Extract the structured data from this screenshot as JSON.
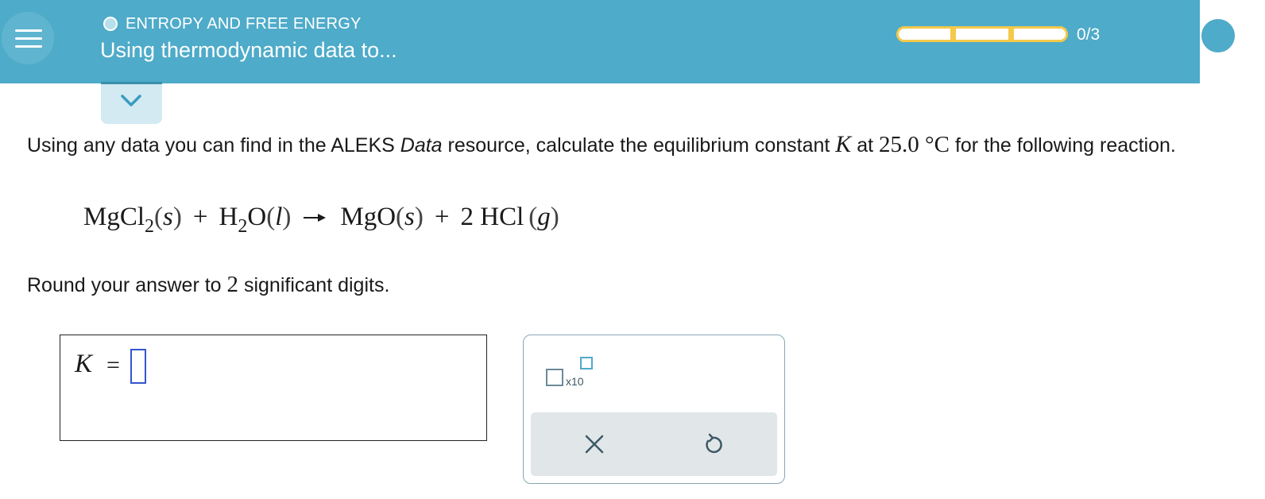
{
  "header": {
    "topic": "ENTROPY AND FREE ENERGY",
    "title": "Using thermodynamic data to...",
    "progress_text": "0/3",
    "progress_value": 0,
    "progress_total": 3,
    "background_color": "#4eabc9",
    "progress_color": "#f5c94a"
  },
  "icons": {
    "menu": "hamburger-menu-icon",
    "collapse": "chevron-down-icon",
    "clear": "close-icon",
    "undo": "undo-icon"
  },
  "question": {
    "part1": "Using any data you can find in the ALEKS ",
    "data_word": "Data",
    "part2": " resource, calculate the equilibrium constant ",
    "k_symbol": "K",
    "part3": " at ",
    "temperature": "25.0 °C",
    "part4": " for the following reaction."
  },
  "reaction": {
    "r1": "MgCl",
    "r1_sub": "2",
    "r1_state": "s",
    "plus1": "+",
    "r2a": "H",
    "r2_sub": "2",
    "r2b": "O",
    "r2_state": "l",
    "p1": "MgO",
    "p1_state": "s",
    "plus2": "+",
    "p2": "2 HCl",
    "p2_state": "g"
  },
  "instructions": {
    "round_prefix": "Round your answer to ",
    "digits": "2",
    "round_suffix": " significant digits."
  },
  "answer": {
    "variable": "K",
    "equals": "=",
    "value": ""
  },
  "tools": {
    "sci_label": "x10"
  }
}
